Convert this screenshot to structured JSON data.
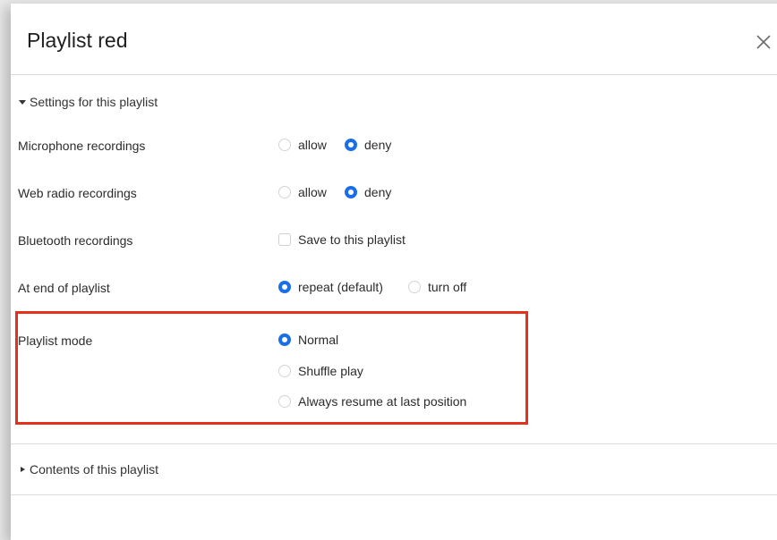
{
  "dialog": {
    "title": "Playlist red",
    "close_icon": "close-icon"
  },
  "settings_section": {
    "label": "Settings for this playlist",
    "expanded": true
  },
  "rows": {
    "microphone": {
      "label": "Microphone recordings",
      "options": [
        "allow",
        "deny"
      ],
      "selected": "deny"
    },
    "web_radio": {
      "label": "Web radio recordings",
      "options": [
        "allow",
        "deny"
      ],
      "selected": "deny"
    },
    "bluetooth": {
      "label": "Bluetooth recordings",
      "checkbox_label": "Save to this playlist",
      "checked": false
    },
    "end_of_playlist": {
      "label": "At end of playlist",
      "options": [
        "repeat (default)",
        "turn off"
      ],
      "selected": "repeat (default)"
    },
    "playlist_mode": {
      "label": "Playlist mode",
      "options": [
        "Normal",
        "Shuffle play",
        "Always resume at last position"
      ],
      "selected": "Normal"
    }
  },
  "contents_section": {
    "label": "Contents of this playlist",
    "expanded": false
  },
  "colors": {
    "accent": "#1a6fe8",
    "highlight_border": "#e3311d"
  }
}
